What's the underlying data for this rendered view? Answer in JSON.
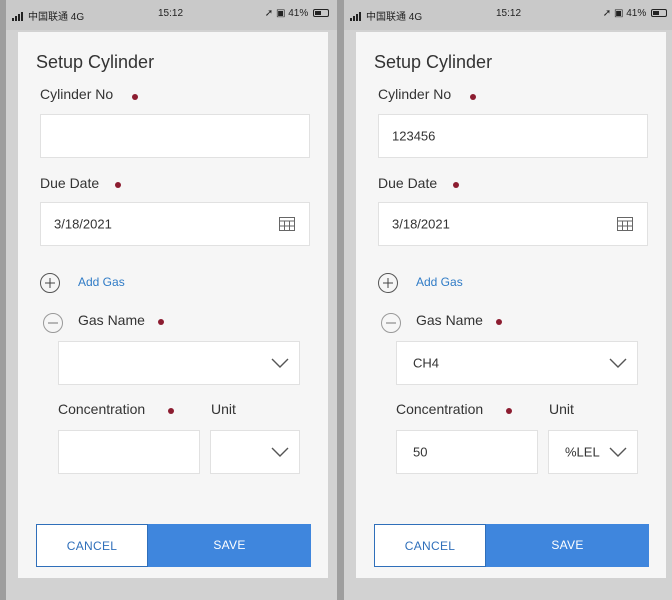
{
  "status_bar": {
    "carrier": "中国联通",
    "network": "4G",
    "time": "15:12",
    "battery": "41%"
  },
  "form": {
    "title": "Setup Cylinder",
    "cylinder_no_label": "Cylinder No",
    "due_date_label": "Due Date",
    "add_gas_label": "Add Gas",
    "gas_name_label": "Gas Name",
    "concentration_label": "Concentration",
    "unit_label": "Unit",
    "cancel_label": "CANCEL",
    "save_label": "SAVE"
  },
  "left": {
    "cylinder_no": "",
    "due_date": "3/18/2021",
    "gas_name": "",
    "concentration": "",
    "unit": ""
  },
  "right": {
    "cylinder_no": "123456",
    "due_date": "3/18/2021",
    "gas_name": "CH4",
    "concentration": "50",
    "unit": "%LEL"
  },
  "colors": {
    "required_dot": "#8c1c30",
    "accent": "#3f86dd",
    "link": "#2f7bc6"
  },
  "icons": [
    "signal-icon",
    "location-icon",
    "lock-icon",
    "battery-icon",
    "calendar-icon",
    "add-circle-icon",
    "remove-circle-icon",
    "chevron-down-icon"
  ]
}
